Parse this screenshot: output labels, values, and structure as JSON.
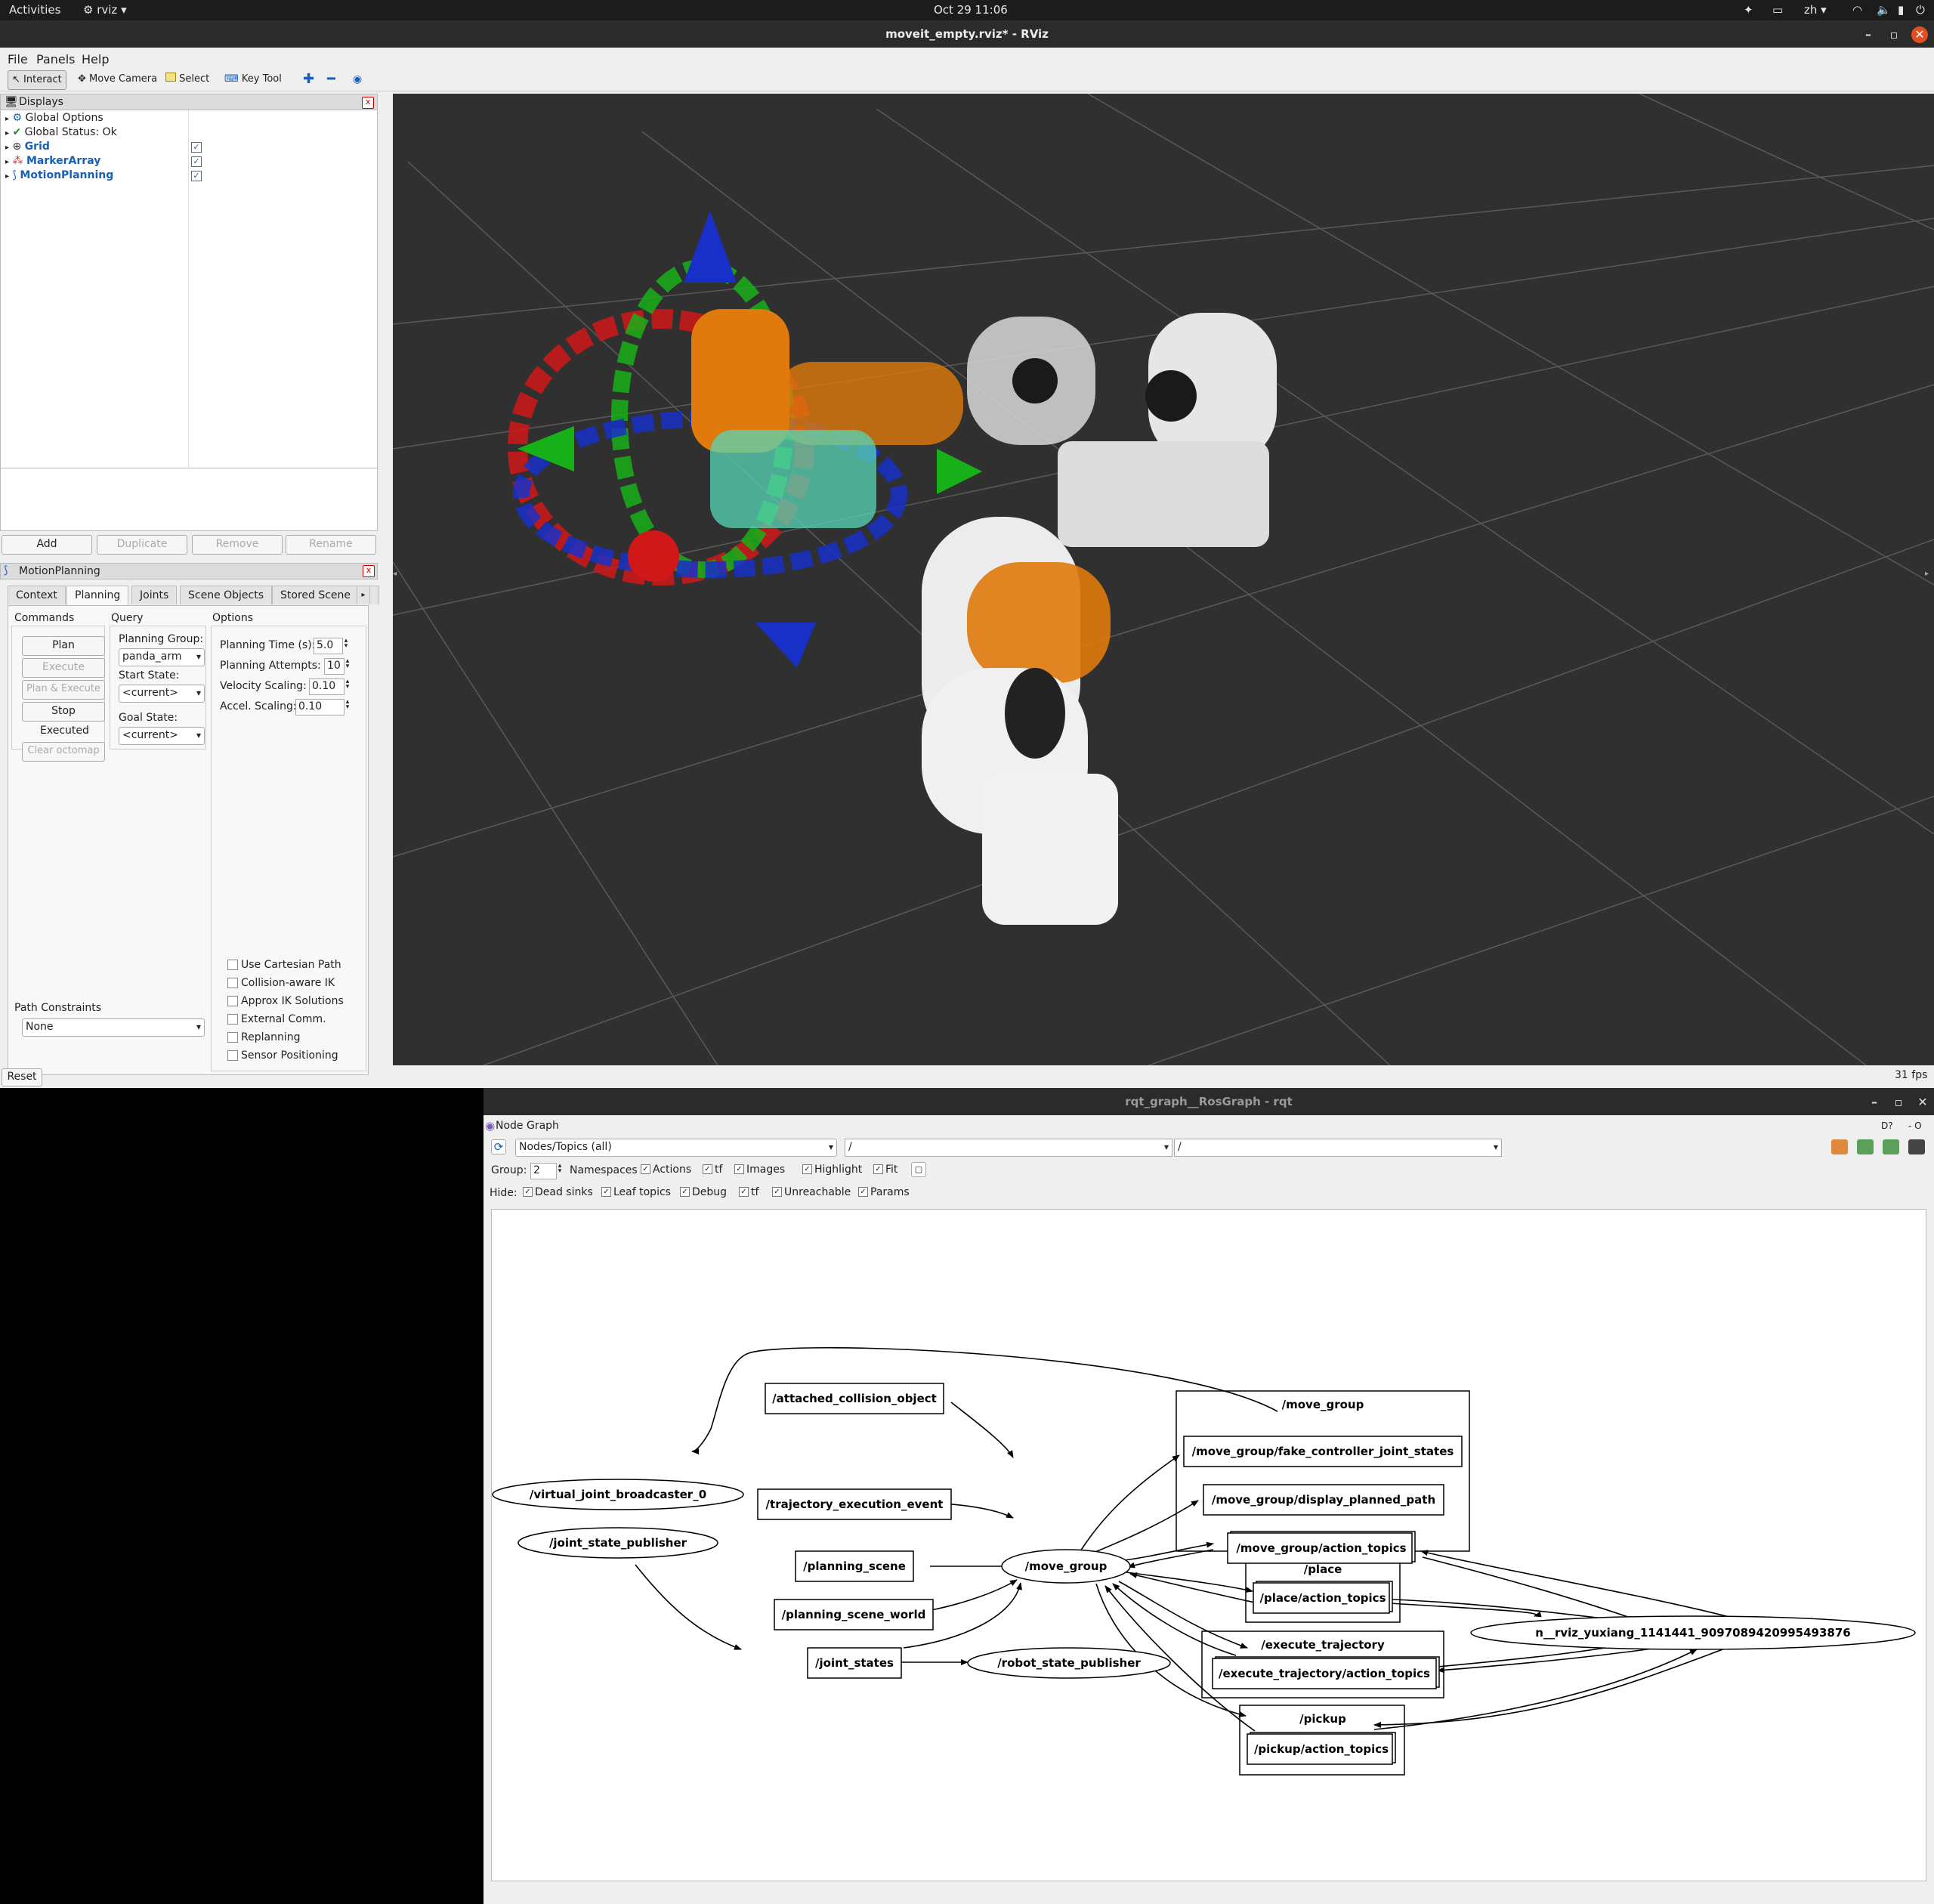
{
  "topbar": {
    "activities": "Activities",
    "app": "rviz",
    "datetime": "Oct 29  11:06",
    "lang": "zh"
  },
  "rviz": {
    "title": "moveit_empty.rviz* - RViz",
    "menu": [
      "File",
      "Panels",
      "Help"
    ],
    "toolbar": {
      "interact": "Interact",
      "move_camera": "Move Camera",
      "select": "Select",
      "key_tool": "Key Tool"
    },
    "displays": {
      "title": "Displays",
      "items": [
        {
          "label": "Global Options",
          "checked": false
        },
        {
          "label": "Global Status: Ok",
          "checked": false
        },
        {
          "label": "Grid",
          "checked": true
        },
        {
          "label": "MarkerArray",
          "checked": true
        },
        {
          "label": "MotionPlanning",
          "checked": true
        }
      ],
      "buttons": [
        "Add",
        "Duplicate",
        "Remove",
        "Rename"
      ]
    },
    "motion_planning": {
      "title": "MotionPlanning",
      "tabs": [
        "Context",
        "Planning",
        "Joints",
        "Scene Objects",
        "Stored Scene"
      ],
      "commands_label": "Commands",
      "query_label": "Query",
      "options_label": "Options",
      "commands": [
        "Plan",
        "Execute",
        "Plan & Execute",
        "Stop",
        "Clear octomap"
      ],
      "status": "Executed",
      "planning_group_label": "Planning Group:",
      "planning_group": "panda_arm",
      "start_state_label": "Start State:",
      "start_state": "<current>",
      "goal_state_label": "Goal State:",
      "goal_state": "<current>",
      "options": [
        {
          "label": "Planning Time (s):",
          "value": "5.0"
        },
        {
          "label": "Planning Attempts:",
          "value": "10"
        },
        {
          "label": "Velocity Scaling:",
          "value": "0.10"
        },
        {
          "label": "Accel. Scaling:",
          "value": "0.10"
        }
      ],
      "checkboxes": [
        "Use Cartesian Path",
        "Collision-aware IK",
        "Approx IK Solutions",
        "External Comm.",
        "Replanning",
        "Sensor Positioning"
      ],
      "path_constraints_label": "Path Constraints",
      "path_constraints": "None"
    },
    "reset": "Reset",
    "fps": "31 fps"
  },
  "rqt": {
    "title": "rqt_graph__RosGraph - rqt",
    "plugin_title": "Node Graph",
    "mode": "Nodes/Topics (all)",
    "filter1": "/",
    "filter2": "/",
    "group_label": "Group:",
    "group_value": "2",
    "group_opts": [
      "Namespaces",
      "Actions",
      "tf",
      "Images",
      "Highlight",
      "Fit"
    ],
    "hide_label": "Hide:",
    "hide_opts": [
      "Dead sinks",
      "Leaf topics",
      "Debug",
      "tf",
      "Unreachable",
      "Params"
    ],
    "graph": {
      "nodes": {
        "virtual_joint_broadcaster": "/virtual_joint_broadcaster_0",
        "joint_state_publisher": "/joint_state_publisher",
        "move_group": "/move_group",
        "robot_state_publisher": "/robot_state_publisher",
        "rviz": "n__rviz_yuxiang_1141441_9097089420995493876"
      },
      "topics": {
        "attached_collision_object": "/attached_collision_object",
        "trajectory_execution_event": "/trajectory_execution_event",
        "planning_scene": "/planning_scene",
        "planning_scene_world": "/planning_scene_world",
        "joint_states": "/joint_states",
        "fake_controller": "/move_group/fake_controller_joint_states",
        "display_planned_path": "/move_group/display_planned_path",
        "mg_action_topics": "/move_group/action_topics",
        "place_action_topics": "/place/action_topics",
        "exec_action_topics": "/execute_trajectory/action_topics",
        "pickup_action_topics": "/pickup/action_topics"
      },
      "groups": {
        "move_group": "/move_group",
        "place": "/place",
        "execute_trajectory": "/execute_trajectory",
        "pickup": "/pickup"
      }
    }
  }
}
